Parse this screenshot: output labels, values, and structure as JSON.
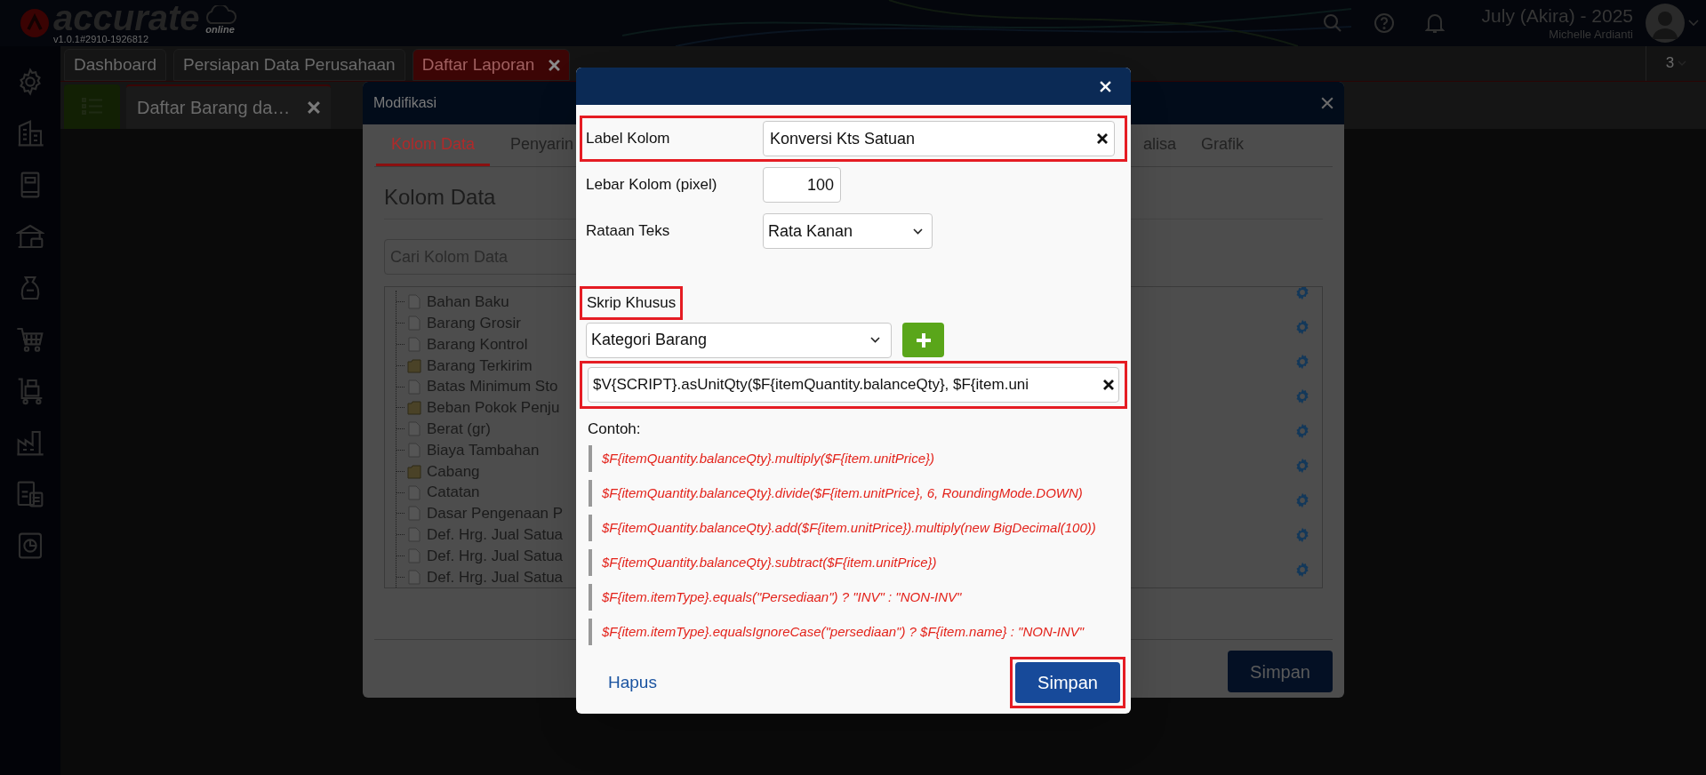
{
  "header": {
    "logo": "accurate",
    "logo_sub": "online",
    "version": "v1.0.1#2910-1926812",
    "period": "July (Akira) - 2025",
    "user": "Michelle Ardianti"
  },
  "tabs": [
    {
      "label": "Dashboard",
      "selected": false,
      "closable": false
    },
    {
      "label": "Persiapan Data Perusahaan",
      "selected": false,
      "closable": false
    },
    {
      "label": "Daftar Laporan",
      "selected": true,
      "closable": true
    }
  ],
  "tab_count": "3",
  "subtabs": [
    {
      "label": "Daftar Barang da…",
      "selected": true,
      "closable": true
    }
  ],
  "background_dialog": {
    "title": "Modifikasi",
    "tabs": [
      {
        "label": "Kolom Data",
        "selected": true
      },
      {
        "label": "Penyarin",
        "selected": false
      },
      {
        "label": "alisa",
        "selected": false
      },
      {
        "label": "Grafik",
        "selected": false
      }
    ],
    "heading": "Kolom Data",
    "search": {
      "placeholder": "Cari Kolom Data"
    },
    "tree": [
      {
        "label": "Bahan Baku",
        "kind": "file"
      },
      {
        "label": "Barang Grosir",
        "kind": "file"
      },
      {
        "label": "Barang Kontrol",
        "kind": "file"
      },
      {
        "label": "Barang Terkirim",
        "kind": "folder"
      },
      {
        "label": "Batas Minimum Sto",
        "kind": "file"
      },
      {
        "label": "Beban Pokok Penju",
        "kind": "folder"
      },
      {
        "label": "Berat (gr)",
        "kind": "file"
      },
      {
        "label": "Biaya Tambahan",
        "kind": "file"
      },
      {
        "label": "Cabang",
        "kind": "folder"
      },
      {
        "label": "Catatan",
        "kind": "file"
      },
      {
        "label": "Dasar Pengenaan P",
        "kind": "file"
      },
      {
        "label": "Def. Hrg. Jual Satua",
        "kind": "file"
      },
      {
        "label": "Def. Hrg. Jual Satua",
        "kind": "file"
      },
      {
        "label": "Def. Hrg. Jual Satua",
        "kind": "file"
      }
    ],
    "save": "Simpan"
  },
  "dialog": {
    "fields": [
      {
        "kind": "text",
        "label": "Label Kolom",
        "value": "Konversi Kts Satuan",
        "highlighted": true
      },
      {
        "kind": "number",
        "label": "Lebar Kolom (pixel)",
        "value": "100",
        "highlighted": false
      },
      {
        "kind": "select",
        "label": "Rataan Teks",
        "value": "Rata Kanan",
        "highlighted": false
      }
    ],
    "script": {
      "label": "Skrip Khusus",
      "label_highlighted": true,
      "category": "Kategori Barang",
      "value": "$V{SCRIPT}.asUnitQty($F{itemQuantity.balanceQty}, $F{item.uni",
      "value_highlighted": true
    },
    "examples_label": "Contoh:",
    "examples": [
      "$F{itemQuantity.balanceQty}.multiply($F{item.unitPrice})",
      "$F{itemQuantity.balanceQty}.divide($F{item.unitPrice}, 6, RoundingMode.DOWN)",
      "$F{itemQuantity.balanceQty}.add($F{item.unitPrice}).multiply(new BigDecimal(100))",
      "$F{itemQuantity.balanceQty}.subtract($F{item.unitPrice})",
      "$F{item.itemType}.equals(\"Persediaan\") ? \"INV\" : \"NON-INV\"",
      "$F{item.itemType}.equalsIgnoreCase(\"persediaan\") ? $F{item.name} : \"NON-INV\""
    ],
    "delete": "Hapus",
    "save": {
      "label": "Simpan",
      "highlighted": true
    }
  }
}
